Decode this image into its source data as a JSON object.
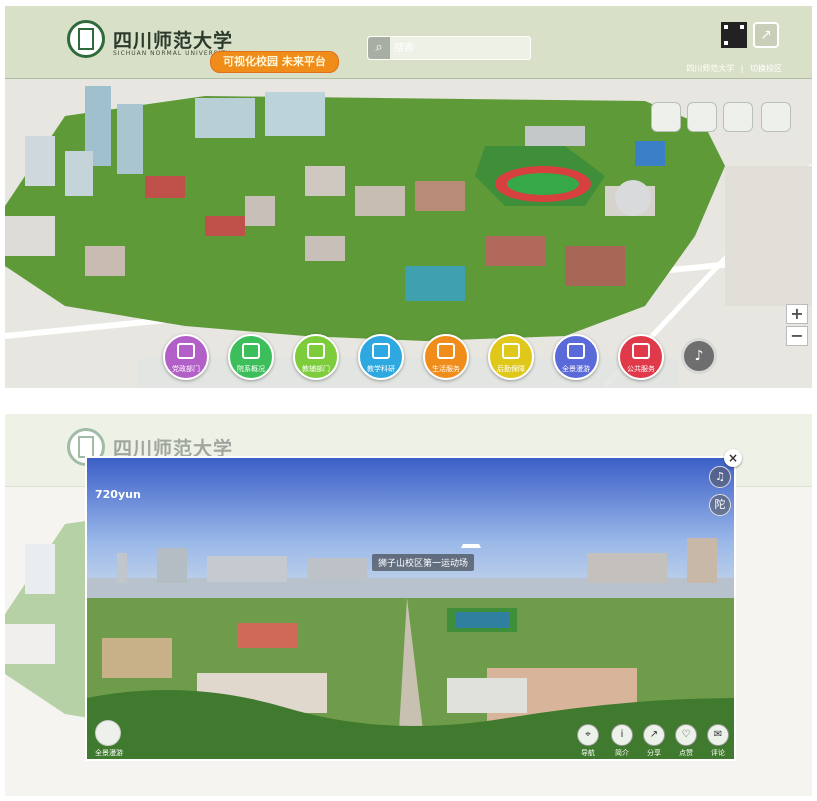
{
  "top_view": {
    "header": {
      "logo_text": "四川师范大学",
      "logo_subtext": "SICHUAN NORMAL UNIVERSITY",
      "platform_badge": "可视化校园 未来平台",
      "search_placeholder": "搜索",
      "links": [
        "四川师范大学",
        "|",
        "切换校区"
      ]
    },
    "categories": [
      {
        "label": "党政部门",
        "color": "#b35fc8"
      },
      {
        "label": "院系概况",
        "color": "#3cbf5a"
      },
      {
        "label": "教辅部门",
        "color": "#7ccc3c"
      },
      {
        "label": "教学科研",
        "color": "#2ea8e0"
      },
      {
        "label": "生活服务",
        "color": "#f08c1a"
      },
      {
        "label": "后勤保障",
        "color": "#e0c81a"
      },
      {
        "label": "全景漫游",
        "color": "#5a6ad8"
      },
      {
        "label": "公共服务",
        "color": "#e03a4a"
      }
    ],
    "zoom": {
      "in": "+",
      "out": "−"
    }
  },
  "bottom_view": {
    "panorama": {
      "provider": "720yun",
      "hotspot_title": "狮子山校区第一运动场",
      "thumb_label": "全景漫游",
      "tools": [
        "导航",
        "简介",
        "分享",
        "点赞",
        "评论"
      ]
    },
    "side_buttons": [
      "♫",
      "陀"
    ],
    "close_label": "×"
  },
  "icons": [
    "search-icon",
    "qr-code-icon",
    "share-icon",
    "sound-icon",
    "music-icon",
    "close-icon",
    "pin-icon",
    "info-icon",
    "share-icon",
    "like-icon",
    "comment-icon"
  ]
}
